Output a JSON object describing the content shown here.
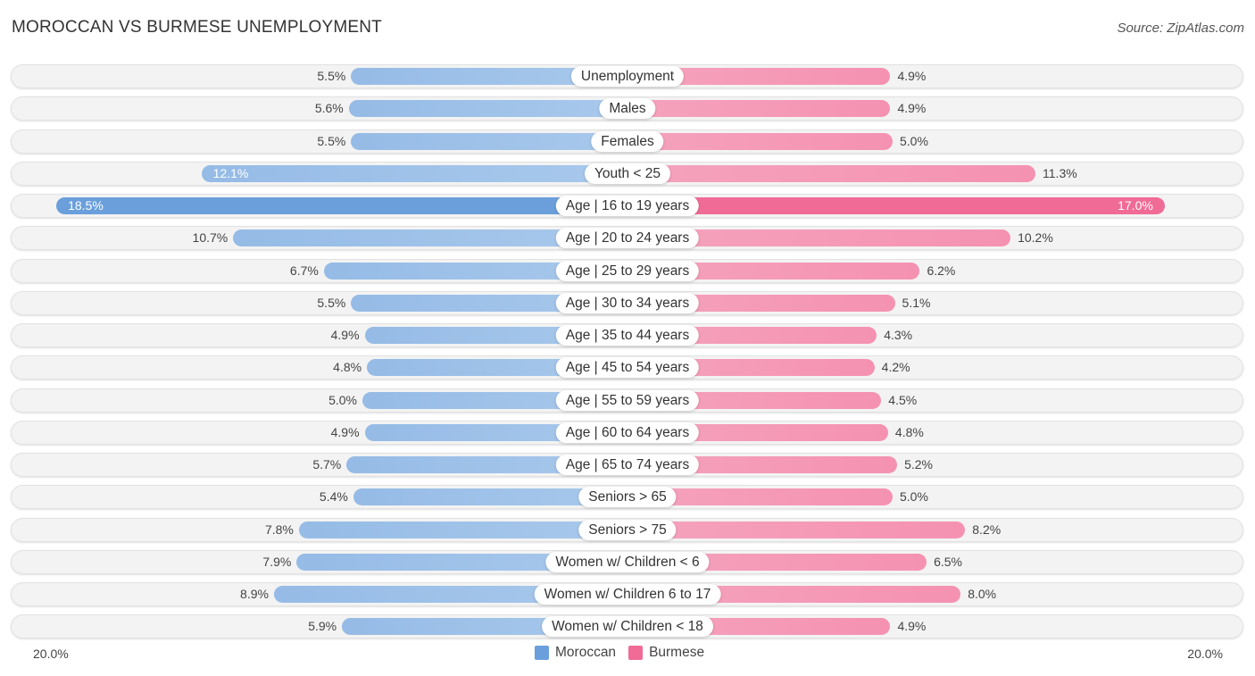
{
  "header": {
    "title": "MOROCCAN VS BURMESE UNEMPLOYMENT",
    "source": "Source: ZipAtlas.com"
  },
  "colors": {
    "moroccan": "#6a9fdc",
    "burmese": "#f06b96"
  },
  "chart_data": {
    "type": "bar",
    "orientation": "horizontal-diverging",
    "title": "MOROCCAN VS BURMESE UNEMPLOYMENT",
    "categories": [
      "Unemployment",
      "Males",
      "Females",
      "Youth < 25",
      "Age | 16 to 19 years",
      "Age | 20 to 24 years",
      "Age | 25 to 29 years",
      "Age | 30 to 34 years",
      "Age | 35 to 44 years",
      "Age | 45 to 54 years",
      "Age | 55 to 59 years",
      "Age | 60 to 64 years",
      "Age | 65 to 74 years",
      "Seniors > 65",
      "Seniors > 75",
      "Women w/ Children < 6",
      "Women w/ Children 6 to 17",
      "Women w/ Children < 18"
    ],
    "series": [
      {
        "name": "Moroccan",
        "side": "left",
        "values": [
          5.5,
          5.6,
          5.5,
          12.1,
          18.5,
          10.7,
          6.7,
          5.5,
          4.9,
          4.8,
          5.0,
          4.9,
          5.7,
          5.4,
          7.8,
          7.9,
          8.9,
          5.9
        ],
        "labels": [
          "5.5%",
          "5.6%",
          "5.5%",
          "12.1%",
          "18.5%",
          "10.7%",
          "6.7%",
          "5.5%",
          "4.9%",
          "4.8%",
          "5.0%",
          "4.9%",
          "5.7%",
          "5.4%",
          "7.8%",
          "7.9%",
          "8.9%",
          "5.9%"
        ]
      },
      {
        "name": "Burmese",
        "side": "right",
        "values": [
          4.9,
          4.9,
          5.0,
          11.3,
          17.0,
          10.2,
          6.2,
          5.1,
          4.3,
          4.2,
          4.5,
          4.8,
          5.2,
          5.0,
          8.2,
          6.5,
          8.0,
          4.9
        ],
        "labels": [
          "4.9%",
          "4.9%",
          "5.0%",
          "11.3%",
          "17.0%",
          "10.2%",
          "6.2%",
          "5.1%",
          "4.3%",
          "4.2%",
          "4.5%",
          "4.8%",
          "5.2%",
          "5.0%",
          "8.2%",
          "6.5%",
          "8.0%",
          "4.9%"
        ]
      }
    ],
    "axis": {
      "left_max_label": "20.0%",
      "right_max_label": "20.0%",
      "max": 20.0
    },
    "legend": {
      "entries": [
        "Moroccan",
        "Burmese"
      ],
      "placement": "bottom-center"
    },
    "highlighted_category": "Age | 16 to 19 years",
    "unit": "%"
  }
}
